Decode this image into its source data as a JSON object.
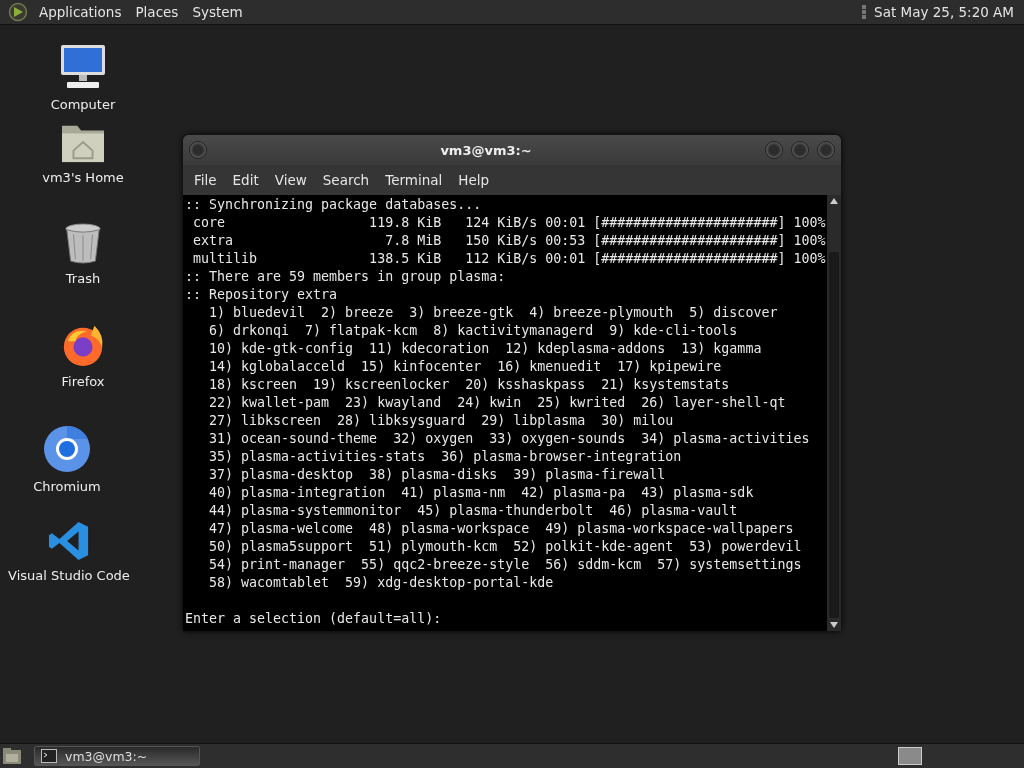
{
  "top_panel": {
    "menus": [
      "Applications",
      "Places",
      "System"
    ],
    "clock": "Sat May 25, 5:20 AM"
  },
  "desktop_icons": [
    {
      "kind": "computer",
      "label": "Computer"
    },
    {
      "kind": "home",
      "label": "vm3's Home"
    },
    {
      "kind": "trash",
      "label": "Trash"
    },
    {
      "kind": "firefox",
      "label": "Firefox"
    },
    {
      "kind": "chromium",
      "label": "Chromium"
    },
    {
      "kind": "vscode",
      "label": "Visual Studio Code"
    }
  ],
  "window": {
    "title": "vm3@vm3:~",
    "menu": [
      "File",
      "Edit",
      "View",
      "Search",
      "Terminal",
      "Help"
    ],
    "lines": [
      ":: Synchronizing package databases...",
      " core                  119.8 KiB   124 KiB/s 00:01 [######################] 100%",
      " extra                   7.8 MiB   150 KiB/s 00:53 [######################] 100%",
      " multilib              138.5 KiB   112 KiB/s 00:01 [######################] 100%",
      ":: There are 59 members in group plasma:",
      ":: Repository extra",
      "   1) bluedevil  2) breeze  3) breeze-gtk  4) breeze-plymouth  5) discover",
      "   6) drkonqi  7) flatpak-kcm  8) kactivitymanagerd  9) kde-cli-tools",
      "   10) kde-gtk-config  11) kdecoration  12) kdeplasma-addons  13) kgamma",
      "   14) kglobalacceld  15) kinfocenter  16) kmenuedit  17) kpipewire",
      "   18) kscreen  19) kscreenlocker  20) ksshaskpass  21) ksystemstats",
      "   22) kwallet-pam  23) kwayland  24) kwin  25) kwrited  26) layer-shell-qt",
      "   27) libkscreen  28) libksysguard  29) libplasma  30) milou",
      "   31) ocean-sound-theme  32) oxygen  33) oxygen-sounds  34) plasma-activities",
      "   35) plasma-activities-stats  36) plasma-browser-integration",
      "   37) plasma-desktop  38) plasma-disks  39) plasma-firewall",
      "   40) plasma-integration  41) plasma-nm  42) plasma-pa  43) plasma-sdk",
      "   44) plasma-systemmonitor  45) plasma-thunderbolt  46) plasma-vault",
      "   47) plasma-welcome  48) plasma-workspace  49) plasma-workspace-wallpapers",
      "   50) plasma5support  51) plymouth-kcm  52) polkit-kde-agent  53) powerdevil",
      "   54) print-manager  55) qqc2-breeze-style  56) sddm-kcm  57) systemsettings",
      "   58) wacomtablet  59) xdg-desktop-portal-kde"
    ],
    "prompt": "Enter a selection (default=all): "
  },
  "taskbar": {
    "tasks": [
      {
        "label": "vm3@vm3:~",
        "selected": true
      }
    ]
  }
}
